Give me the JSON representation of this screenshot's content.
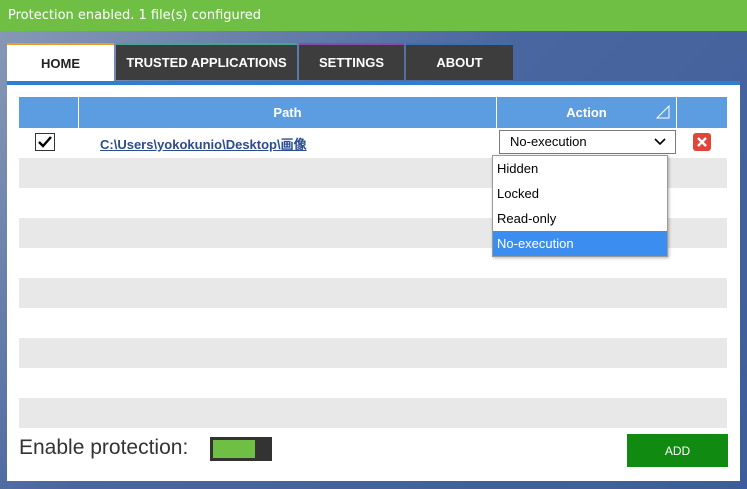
{
  "status": {
    "text": "Protection enabled. 1 file(s) configured"
  },
  "tabs": [
    {
      "label": "HOME",
      "active": true
    },
    {
      "label": "TRUSTED APPLICATIONS",
      "active": false
    },
    {
      "label": "SETTINGS",
      "active": false
    },
    {
      "label": "ABOUT",
      "active": false
    }
  ],
  "table": {
    "headers": {
      "path": "Path",
      "action": "Action"
    },
    "rows": [
      {
        "checked": true,
        "path": "C:\\Users\\yokokunio\\Desktop\\画像",
        "action": "No-execution"
      }
    ]
  },
  "dropdown": {
    "options": [
      "Hidden",
      "Locked",
      "Read-only",
      "No-execution"
    ],
    "selected": "No-execution"
  },
  "footer": {
    "enable_label": "Enable protection:",
    "toggle_on": true,
    "add_label": "ADD"
  },
  "colors": {
    "status_green": "#6fbf45",
    "header_blue": "#5b9de0",
    "add_green": "#108a10",
    "delete_red": "#e0453a"
  }
}
